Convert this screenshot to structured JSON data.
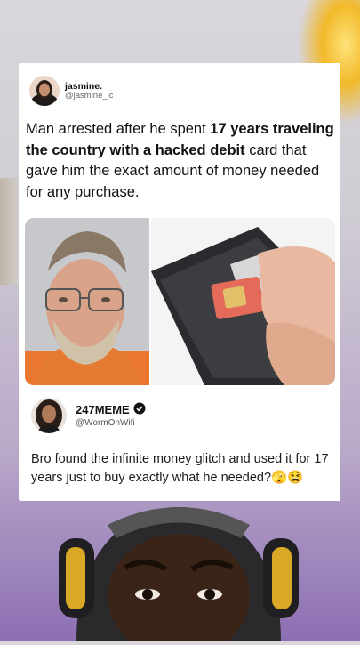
{
  "post": {
    "name": "jasmine.",
    "handle": "@jasmine_lc",
    "text_before": "Man arrested after he spent ",
    "text_bold": "17 years traveling the country with a hacked debit",
    "text_after": " card that gave him the exact amount of money needed for any purchase."
  },
  "reply": {
    "name": "247MEME",
    "verified_icon": "verified-badge-icon",
    "handle": "@WormOnWifi",
    "text": "Bro found the infinite money glitch and used it for 17 years just to buy exactly what he needed?🫣😫"
  },
  "colors": {
    "card": "#ffffff",
    "text": "#111111",
    "light": "#f2b92a"
  }
}
